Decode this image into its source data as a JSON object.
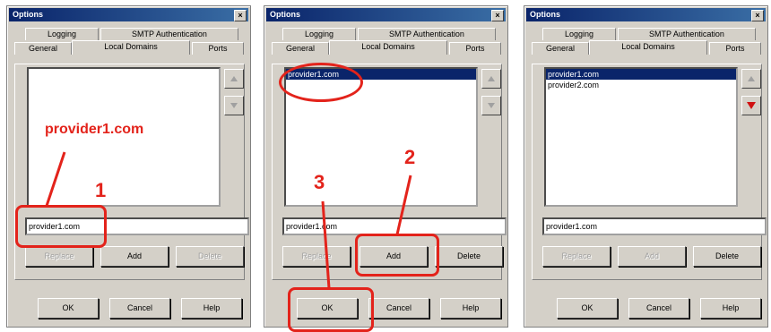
{
  "colors": {
    "annotation": "#e3231b",
    "title_bar": "#0a246a",
    "dialog_bg": "#d4d0c8"
  },
  "dialogs": [
    {
      "title": "Options",
      "tabs_back": [
        "Logging",
        "SMTP Authentication"
      ],
      "tabs_front": [
        "General",
        "Local Domains",
        "Ports"
      ],
      "active_tab": "Local Domains",
      "list_items": [],
      "input_value": "provider1.com",
      "buttons": {
        "replace": "Replace",
        "add": "Add",
        "delete": "Delete"
      },
      "footer": {
        "ok": "OK",
        "cancel": "Cancel",
        "help": "Help"
      },
      "side_icons": [
        "arrow-up-icon",
        "arrow-down-icon"
      ]
    },
    {
      "title": "Options",
      "tabs_back": [
        "Logging",
        "SMTP Authentication"
      ],
      "tabs_front": [
        "General",
        "Local Domains",
        "Ports"
      ],
      "active_tab": "Local Domains",
      "list_items": [
        "provider1.com"
      ],
      "input_value": "provider1.com",
      "buttons": {
        "replace": "Replace",
        "add": "Add",
        "delete": "Delete"
      },
      "footer": {
        "ok": "OK",
        "cancel": "Cancel",
        "help": "Help"
      },
      "side_icons": [
        "arrow-up-icon",
        "arrow-down-icon"
      ]
    },
    {
      "title": "Options",
      "tabs_back": [
        "Logging",
        "SMTP Authentication"
      ],
      "tabs_front": [
        "General",
        "Local Domains",
        "Ports"
      ],
      "active_tab": "Local Domains",
      "list_items": [
        "provider1.com",
        "provider2.com"
      ],
      "input_value": "provider1.com",
      "buttons": {
        "replace": "Replace",
        "add": "Add",
        "delete": "Delete"
      },
      "footer": {
        "ok": "OK",
        "cancel": "Cancel",
        "help": "Help"
      },
      "side_icons": [
        "arrow-up-icon",
        "arrow-down-icon"
      ]
    }
  ],
  "annotations": {
    "label": "provider1.com",
    "step1": "1",
    "step2": "2",
    "step3": "3"
  }
}
